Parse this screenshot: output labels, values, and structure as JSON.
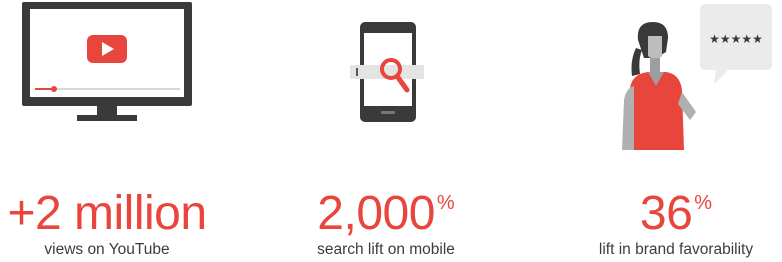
{
  "stats": [
    {
      "id": "youtube",
      "figure": "+2 million",
      "suffix": "",
      "caption": "views on YouTube",
      "icon": "tv-play-icon"
    },
    {
      "id": "search",
      "figure": "2,000",
      "suffix": "%",
      "caption": "search lift on mobile",
      "icon": "phone-search-icon"
    },
    {
      "id": "brand",
      "figure": "36",
      "suffix": "%",
      "caption": "lift in brand favorability",
      "icon": "woman-review-icon",
      "rating_stars": "★★★★★"
    }
  ],
  "colors": {
    "accent": "#e8453c",
    "dark": "#3a3a3a",
    "caption": "#3c3c3c"
  }
}
